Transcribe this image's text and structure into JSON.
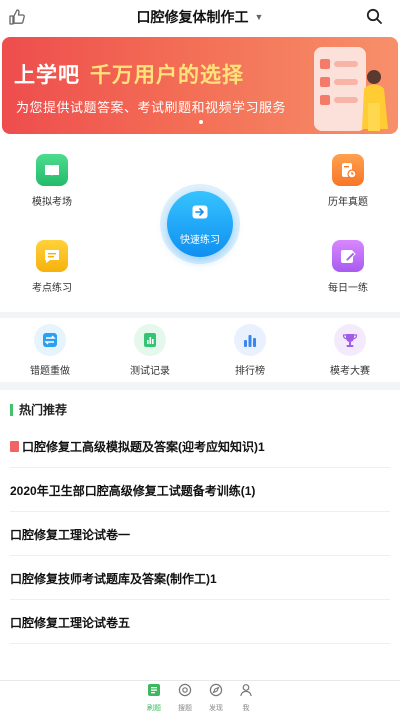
{
  "header": {
    "title": "口腔修复体制作工",
    "caret": "▼"
  },
  "banner": {
    "title_main": "上学吧",
    "title_highlight": "千万用户的选择",
    "subtitle": "为您提供试题答案、考试刷题和视频学习服务"
  },
  "quick": {
    "mock_exam": "模拟考场",
    "past_papers": "历年真题",
    "fast_practice": "快速练习",
    "key_points": "考点练习",
    "daily": "每日一练"
  },
  "tools": {
    "wrong_redo": "错题重做",
    "test_records": "测试记录",
    "leaderboard": "排行榜",
    "mock_contest": "模考大赛"
  },
  "hot": {
    "heading": "热门推荐",
    "items": [
      "口腔修复工高级模拟题及答案(迎考应知知识)1",
      "2020年卫生部口腔高级修复工试题备考训练(1)",
      "口腔修复工理论试卷一",
      "口腔修复技师考试题库及答案(制作工)1",
      "口腔修复工理论试卷五"
    ]
  },
  "tabbar": {
    "items": [
      "刷题",
      "搜题",
      "发现",
      "我"
    ],
    "active_color": "#3cb95f"
  },
  "colors": {
    "banner_start": "#ee4d4d",
    "banner_highlight": "#ffe37a",
    "accent_green": "#42c36b",
    "fast_blue": "#0f8ff0"
  }
}
